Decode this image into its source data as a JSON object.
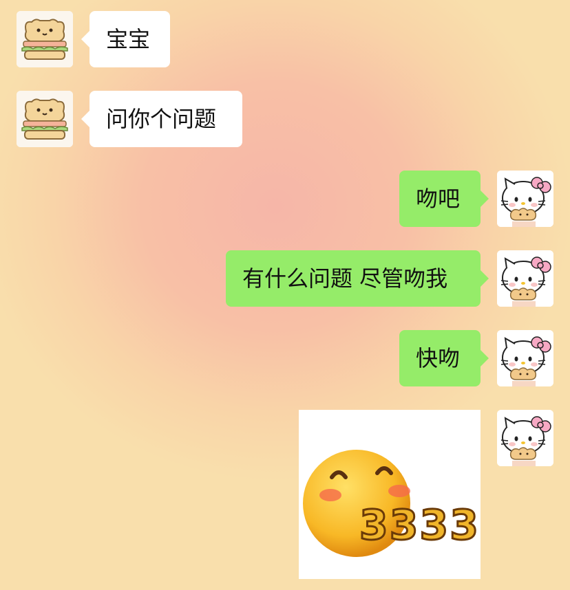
{
  "chat": {
    "messages": [
      {
        "sender": "other",
        "text": "宝宝",
        "avatar_icon": "bread-cat-icon"
      },
      {
        "sender": "other",
        "text": "问你个问题",
        "avatar_icon": "bread-cat-icon"
      },
      {
        "sender": "self",
        "text": "吻吧",
        "avatar_icon": "hello-kitty-icon"
      },
      {
        "sender": "self",
        "text": "有什么问题 尽管吻我",
        "avatar_icon": "hello-kitty-icon"
      },
      {
        "sender": "self",
        "text": "快吻",
        "avatar_icon": "hello-kitty-icon"
      },
      {
        "sender": "self",
        "type": "sticker",
        "sticker_icon": "blushing-emoji-3333-sticker",
        "sticker_text": "3333",
        "avatar_icon": "hello-kitty-icon"
      }
    ]
  },
  "colors": {
    "self_bubble": "#95ec69",
    "other_bubble": "#ffffff",
    "background_center": "#f6b6a8",
    "background_edge": "#f9dfac"
  }
}
